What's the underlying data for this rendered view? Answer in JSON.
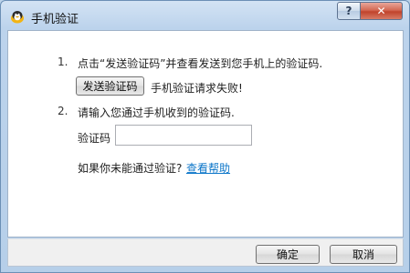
{
  "window": {
    "title": "手机验证",
    "help_label": "?",
    "close_label": "✕",
    "icon": "qq-penguin-icon"
  },
  "steps": [
    {
      "number": "1.",
      "text": "点击“发送验证码”并查看发送到您手机上的验证码."
    },
    {
      "number": "2.",
      "text": "请输入您通过手机收到的验证码."
    }
  ],
  "send_button": {
    "label": "发送验证码"
  },
  "send_status": "手机验证请求失败!",
  "code_field": {
    "label": "验证码",
    "value": ""
  },
  "help": {
    "prompt": "如果你未能通过验证?",
    "link_label": "查看帮助"
  },
  "footer": {
    "ok_label": "确定",
    "cancel_label": "取消"
  },
  "colors": {
    "link": "#0c76c9",
    "title_bar": "#bcd3ec",
    "close_button": "#c1432c"
  }
}
